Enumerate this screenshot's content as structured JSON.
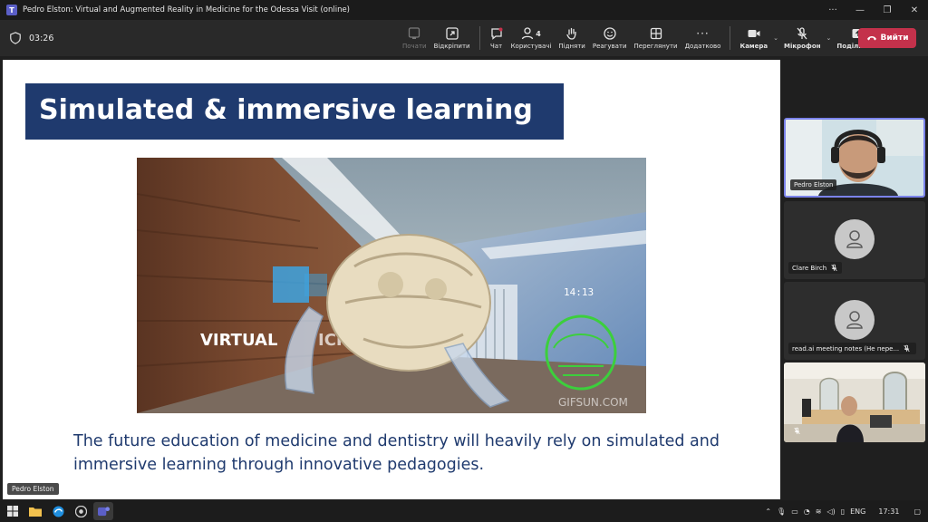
{
  "window": {
    "title": "Pedro Elston: Virtual and Augmented Reality in Medicine for the Odessa Visit (online)"
  },
  "toolbar": {
    "timer": "03:26",
    "items": [
      {
        "label": "Почати",
        "icon": "record-icon",
        "disabled": true
      },
      {
        "label": "Відкріпити",
        "icon": "unpin-icon",
        "disabled": false
      },
      {
        "label": "Чат",
        "icon": "chat-icon",
        "disabled": false
      },
      {
        "label": "Користувачі",
        "icon": "people-icon",
        "disabled": false,
        "count": "4"
      },
      {
        "label": "Підняти",
        "icon": "raise-hand-icon",
        "disabled": false
      },
      {
        "label": "Реагувати",
        "icon": "smile-icon",
        "disabled": false
      },
      {
        "label": "Переглянути",
        "icon": "view-grid-icon",
        "disabled": false
      },
      {
        "label": "Додатково",
        "icon": "more-icon",
        "disabled": false
      },
      {
        "label": "Камера",
        "icon": "camera-icon",
        "disabled": false
      },
      {
        "label": "Мікрофон",
        "icon": "mic-off-icon",
        "disabled": false
      },
      {
        "label": "Поділитися",
        "icon": "share-icon",
        "disabled": false
      }
    ],
    "leave_label": "Вийти"
  },
  "slide": {
    "title": "Simulated & immersive learning",
    "caption": "The future education of medicine and dentistry will heavily rely on simulated and immersive learning through innovative pedagogies.",
    "image_text": {
      "virtual": "VIRTUAL",
      "partial": "ICIN",
      "time": "14:13",
      "watermark": "GIFSUN.COM"
    }
  },
  "presenter_label": "Pedro Elston",
  "participants": [
    {
      "name": "Pedro Elston",
      "video": true,
      "active": true
    },
    {
      "name": "Clare Birch",
      "video": false,
      "muted": true
    },
    {
      "name": "read.ai meeting notes (Не пере...",
      "video": false,
      "muted": true
    },
    {
      "name": "",
      "video": true,
      "muted": true
    }
  ],
  "taskbar": {
    "language": "ENG",
    "time": "17:31"
  },
  "colors": {
    "leave": "#c4314b",
    "slide_title_bg": "#1f3a6e",
    "active_border": "#7b83eb"
  }
}
